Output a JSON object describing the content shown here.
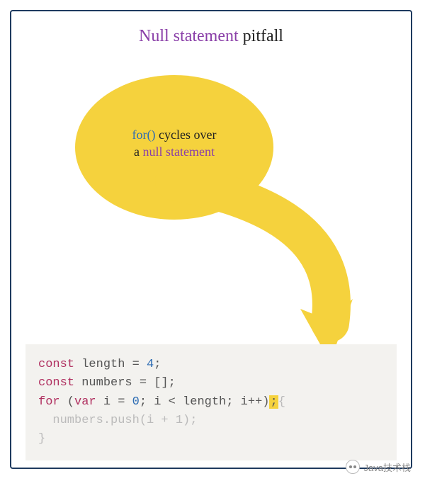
{
  "title": {
    "accent": "Null statement",
    "rest": " pitfall"
  },
  "bubble": {
    "kw_for": "for()",
    "line1_rest": " cycles over",
    "line2_a": "a ",
    "kw_null": "null statement"
  },
  "code": {
    "l1_kw": "const",
    "l1_rest": " length = ",
    "l1_num": "4",
    "l1_semi": ";",
    "l2_kw": "const",
    "l2_rest": " numbers = [];",
    "l3_kw": "for",
    "l3_a": " (",
    "l3_var": "var",
    "l3_b": " i = ",
    "l3_num0": "0",
    "l3_c": "; i < length; i++)",
    "l3_semi": ";",
    "l3_brace": "{",
    "l4_indent": "  numbers.push(i + ",
    "l4_num1": "1",
    "l4_rest": ");",
    "l5": "}"
  },
  "watermark": {
    "text": "Java技术栈"
  }
}
